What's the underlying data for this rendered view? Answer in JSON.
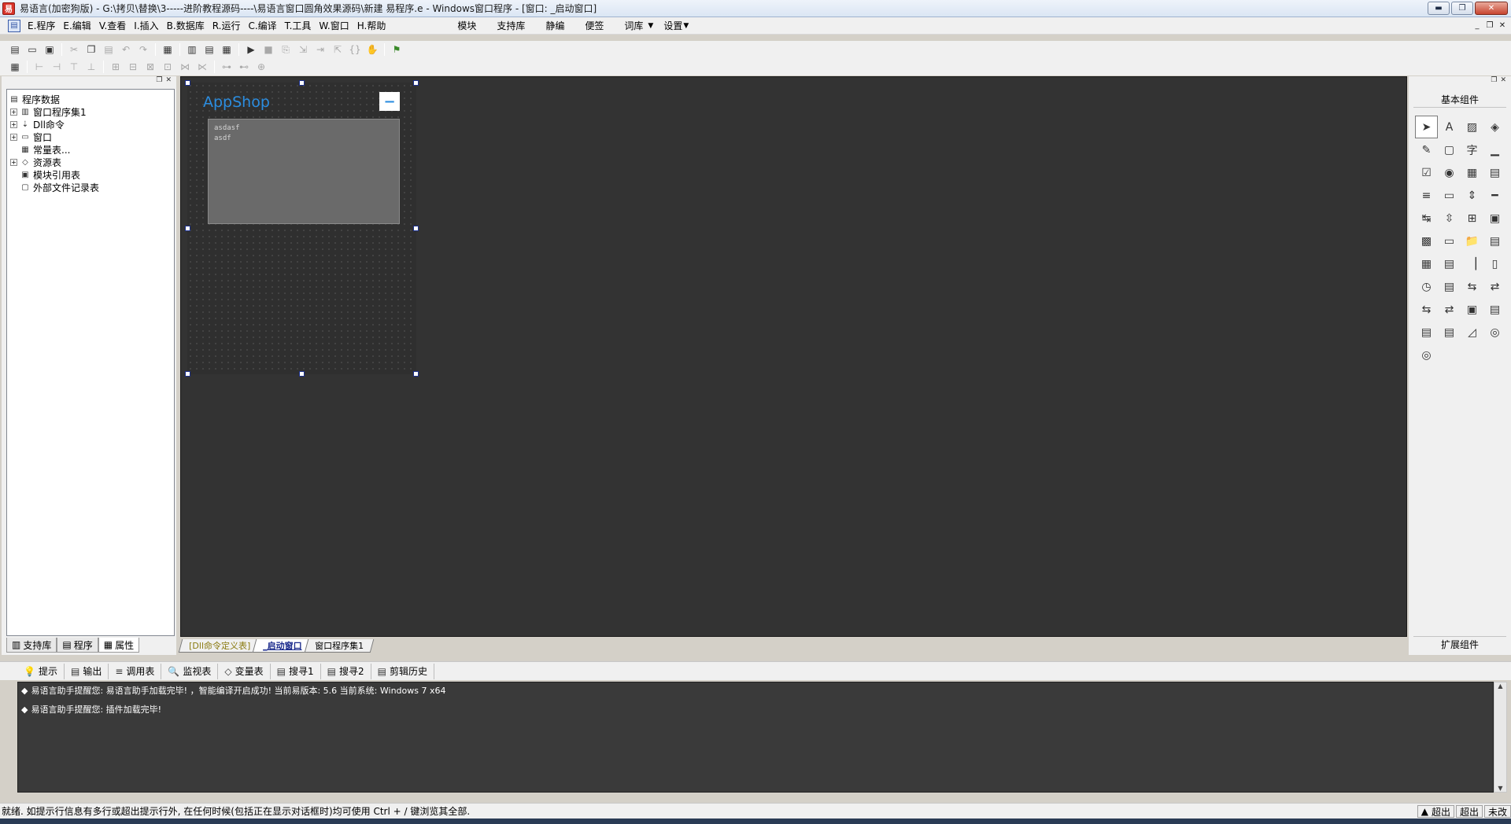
{
  "window": {
    "title": "易语言(加密狗版) - G:\\拷贝\\替换\\3-----进阶教程源码----\\易语言窗口圆角效果源码\\新建 易程序.e - Windows窗口程序 - [窗口: _启动窗口]",
    "min": "▬",
    "max": "❐",
    "close": "✕"
  },
  "menu": {
    "items": [
      "E.程序",
      "E.编辑",
      "V.查看",
      "I.插入",
      "B.数据库",
      "R.运行",
      "C.编译",
      "T.工具",
      "W.窗口",
      "H.帮助"
    ],
    "right": [
      "模块",
      "支持库",
      "静编",
      "便签",
      "词库",
      "设置"
    ],
    "arrow": "▼",
    "mdi": [
      "_",
      "❐",
      "✕"
    ]
  },
  "tree": {
    "items": [
      {
        "label": "程序数据",
        "exp": "",
        "icon": "▤"
      },
      {
        "label": "窗口程序集1",
        "exp": "+",
        "icon": "▥"
      },
      {
        "label": "Dll命令",
        "exp": "+",
        "icon": "⇣"
      },
      {
        "label": "窗口",
        "exp": "+",
        "icon": "▭"
      },
      {
        "label": "常量表...",
        "exp": "",
        "icon": "▦"
      },
      {
        "label": "资源表",
        "exp": "+",
        "icon": "◇"
      },
      {
        "label": "模块引用表",
        "exp": "",
        "icon": "▣"
      },
      {
        "label": "外部文件记录表",
        "exp": "",
        "icon": "▢"
      }
    ]
  },
  "left_tabs": [
    "支持库",
    "程序",
    "属性"
  ],
  "form": {
    "title": "AppShop",
    "min_button": "−",
    "text_lines": [
      "asdasf",
      "asdf"
    ]
  },
  "doc_tabs": [
    "[Dll命令定义表]",
    "_启动窗口",
    "窗口程序集1"
  ],
  "components": {
    "title": "基本组件",
    "ext_title": "扩展组件",
    "icons": [
      "pointer-icon",
      "label-icon",
      "image-icon",
      "shape-icon",
      "edit-icon",
      "text-icon",
      "font-icon",
      "line-icon",
      "checkbox-icon",
      "radio-icon",
      "grid-icon",
      "list-icon",
      "listbox-icon",
      "progress-icon",
      "scroll-icon",
      "slider-icon",
      "hscroll-icon",
      "vscroll-icon",
      "tab-icon",
      "frame-icon",
      "calendar-icon",
      "combo-icon",
      "folder-icon",
      "file-icon",
      "table-icon",
      "printer-icon",
      "ruler-icon",
      "status-icon",
      "timer-icon",
      "printer2-icon",
      "net-icon",
      "net2-icon",
      "client-icon",
      "server-icon",
      "panel-icon",
      "container-icon",
      "db-icon",
      "dbgrid-icon",
      "chart-icon",
      "odbc-icon",
      "odbc2-icon"
    ],
    "glyphs": [
      "➤",
      "A",
      "▨",
      "◈",
      "✎",
      "▢",
      "字",
      "▁",
      "☑",
      "◉",
      "▦",
      "▤",
      "≡",
      "▭",
      "⇕",
      "━",
      "↹",
      "⇳",
      "⊞",
      "▣",
      "▩",
      "▭",
      "📁",
      "▤",
      "▦",
      "▤",
      "▕",
      "▯",
      "◷",
      "▤",
      "⇆",
      "⇄",
      "⇆",
      "⇄",
      "▣",
      "▤",
      "▤",
      "▤",
      "◿",
      "◎",
      "◎"
    ]
  },
  "output_tabs": [
    {
      "label": "提示",
      "icon": "💡"
    },
    {
      "label": "输出",
      "icon": "▤"
    },
    {
      "label": "调用表",
      "icon": "≡"
    },
    {
      "label": "监视表",
      "icon": "🔍"
    },
    {
      "label": "变量表",
      "icon": "◇"
    },
    {
      "label": "搜寻1",
      "icon": "▤"
    },
    {
      "label": "搜寻2",
      "icon": "▤"
    },
    {
      "label": "剪辑历史",
      "icon": "▤"
    }
  ],
  "output": {
    "lines": [
      "易语言助手提醒您: 易语言助手加载完毕! ，智能编译开启成功! 当前易版本: 5.6 当前系统: Windows 7 x64",
      "易语言助手提醒您: 插件加载完毕!"
    ],
    "bullet": "◆"
  },
  "status": {
    "text": "就绪. 如提示行信息有多行或超出提示行外, 在任何时候(包括正在显示对话框时)均可使用 Ctrl + / 键浏览其全部.",
    "boxes": [
      "超出",
      "超出",
      "未改"
    ]
  },
  "colors": {
    "accent": "#2b8de0",
    "canvas": "#333333"
  }
}
